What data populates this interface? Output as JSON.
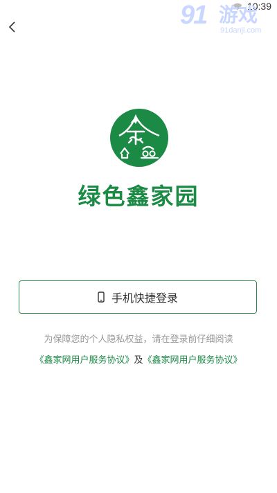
{
  "status_bar": {
    "time": "10:39"
  },
  "watermark": {
    "number": "91",
    "text": "游戏",
    "url": "91danji.com"
  },
  "brand": {
    "name": "绿色鑫家园",
    "color": "#1a8a45"
  },
  "login": {
    "button_label": "手机快捷登录"
  },
  "notice": {
    "text": "为保障您的个人隐私权益，请在登录前仔细阅读"
  },
  "agreements": {
    "first": "《鑫家网用户服务协议》",
    "separator": "及",
    "second": "《鑫家网用户服务协议》"
  },
  "icons": {
    "back": "chevron-left-icon",
    "phone": "phone-icon",
    "wifi": "wifi-icon"
  }
}
